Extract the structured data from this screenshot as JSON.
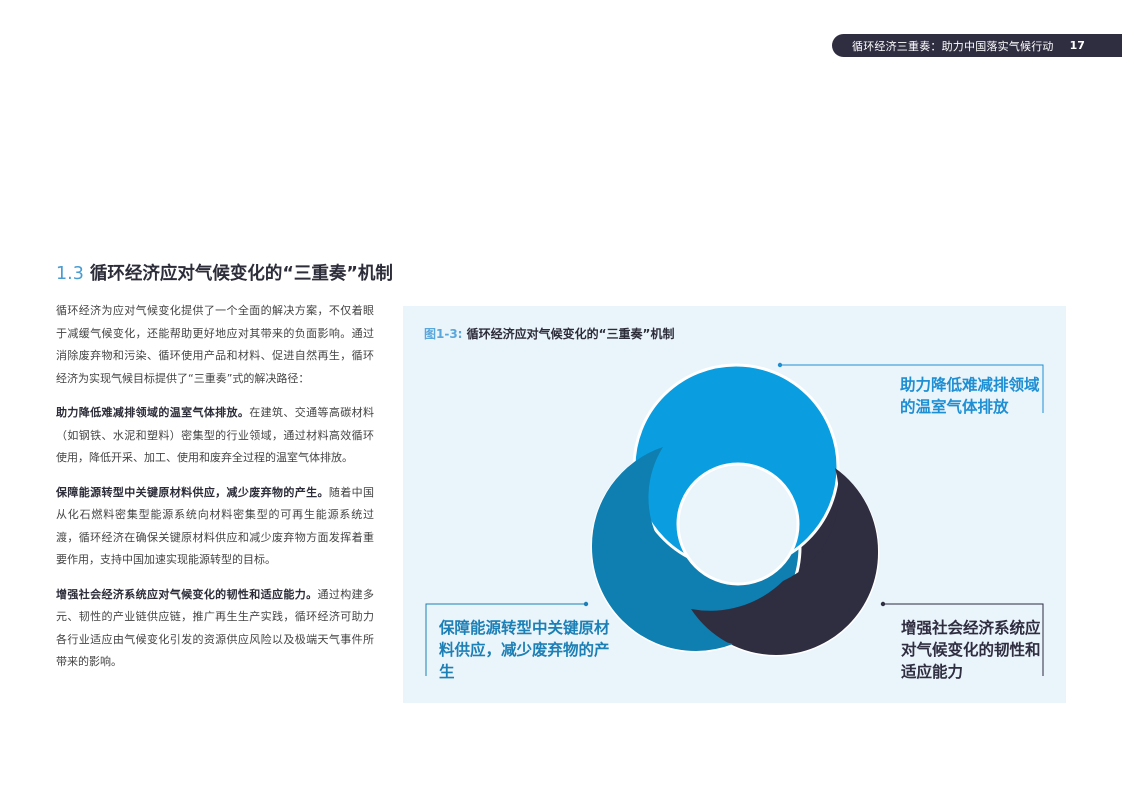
{
  "header": {
    "title": "循环经济三重奏：助力中国落实气候行动",
    "page_number": "17"
  },
  "section": {
    "number": "1.3",
    "title": "循环经济应对气候变化的“三重奏”机制"
  },
  "body": {
    "intro": "循环经济为应对气候变化提供了一个全面的解决方案，不仅着眼于减缓气候变化，还能帮助更好地应对其带来的负面影响。通过消除废弃物和污染、循环使用产品和材料、促进自然再生，循环经济为实现气候目标提供了“三重奏”式的解决路径：",
    "p1_lead": "助力降低难减排领域的温室气体排放。",
    "p1_text": "在建筑、交通等高碳材料（如钢铁、水泥和塑料）密集型的行业领域，通过材料高效循环使用，降低开采、加工、使用和废弃全过程的温室气体排放。",
    "p2_lead": "保障能源转型中关键原材料供应，减少废弃物的产生。",
    "p2_text": "随着中国从化石燃料密集型能源系统向材料密集型的可再生能源系统过渡，循环经济在确保关键原材料供应和减少废弃物方面发挥着重要作用，支持中国加速实现能源转型的目标。",
    "p3_lead": "增强社会经济系统应对气候变化的韧性和适应能力。",
    "p3_text": "通过构建多元、韧性的产业链供应链，推广再生生产实践，循环经济可助力各行业适应由气候变化引发的资源供应风险以及极端天气事件所带来的影响。"
  },
  "figure": {
    "label": "图1-3:",
    "title": "循环经济应对气候变化的“三重奏”机制",
    "callouts": {
      "top_right": "助力降低难减排领域的温室气体排放",
      "bottom_left": "保障能源转型中关键原材料供应，减少废弃物的产生",
      "bottom_right": "增强社会经济系统应对气候变化的韧性和适应能力"
    },
    "colors": {
      "panel_bg": "#eaf4fb",
      "blue_light": "#0a9ee0",
      "blue_mid": "#0e7fb0",
      "dark": "#2f2d40"
    }
  }
}
